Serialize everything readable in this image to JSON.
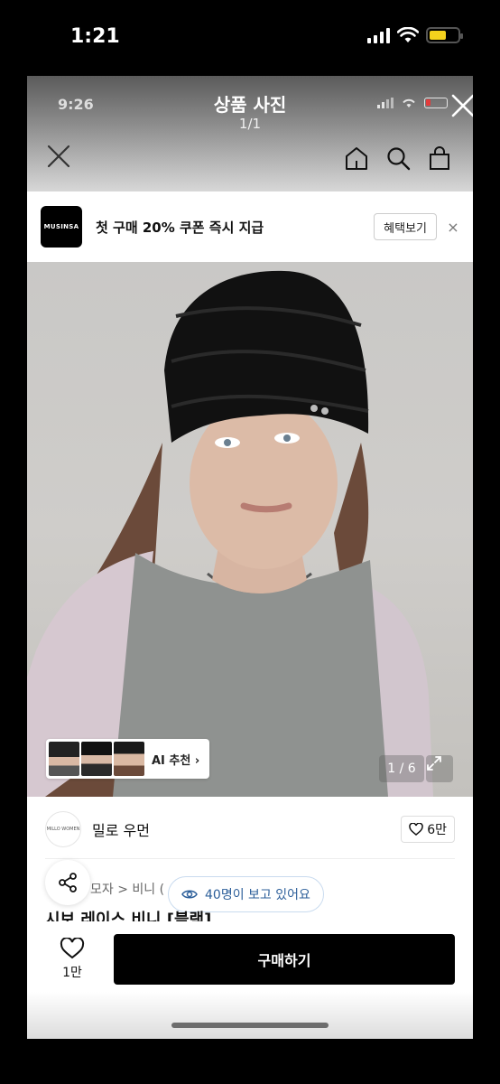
{
  "outer_status": {
    "time": "1:21"
  },
  "inner_status": {
    "time": "9:26"
  },
  "viewer": {
    "title": "상품 사진",
    "counter": "1/1"
  },
  "banner": {
    "logo": "MUSINSA",
    "text": "첫 구매 20% 쿠폰 즉시 지급",
    "button": "혜택보기",
    "close": "×"
  },
  "photo": {
    "ai_label": "AI 추천",
    "ai_arrow": "›",
    "page": "1 / 6"
  },
  "product": {
    "brand_logo": "MILLO WOMEN",
    "brand_name": "밀로 우먼",
    "likes": "6만",
    "breadcrumb": "모자 > 비니 (",
    "viewers_text": "40명이 보고 있어요",
    "name": "시보 레이스 비니 [블랙]"
  },
  "bottom": {
    "wish_count": "1만",
    "buy_label": "구매하기"
  },
  "colors": {
    "accent_blue": "#2d5f9a",
    "buy_button": "#000000",
    "battery_yellow": "#f5d21d"
  }
}
